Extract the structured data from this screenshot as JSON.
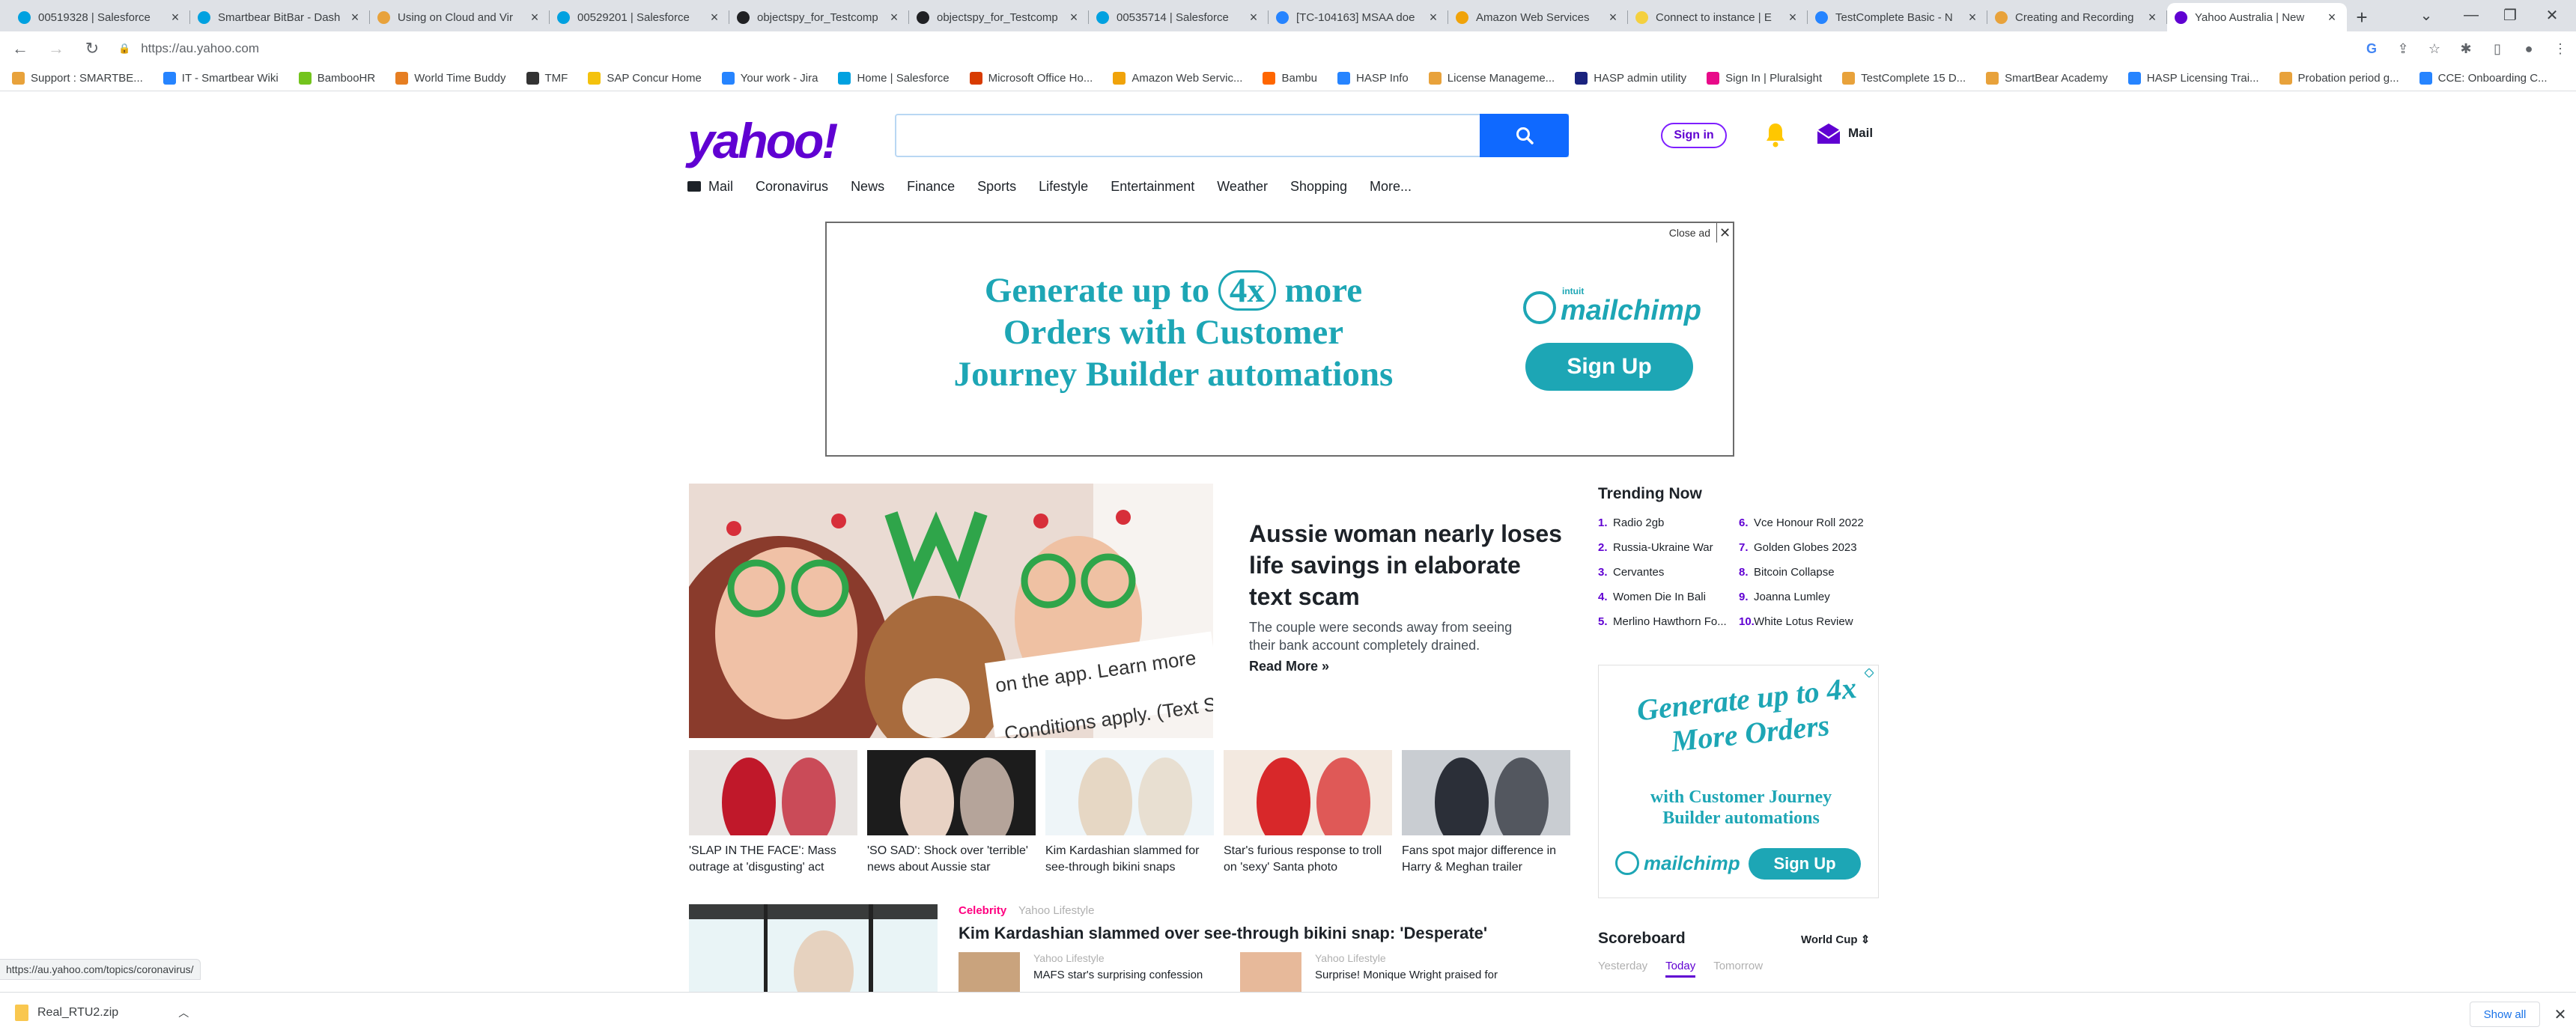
{
  "browser": {
    "tabs": [
      {
        "title": "00519328 | Salesforce",
        "color": "#00a1e0",
        "icon": "salesforce-icon"
      },
      {
        "title": "Smartbear BitBar - Dash",
        "color": "#00a1e0",
        "icon": "bitbar-icon"
      },
      {
        "title": "Using on Cloud and Vir",
        "color": "#e8a23b",
        "icon": "confluence-icon"
      },
      {
        "title": "00529201 | Salesforce",
        "color": "#00a1e0",
        "icon": "salesforce-icon"
      },
      {
        "title": "objectspy_for_Testcomp",
        "color": "#202124",
        "icon": "github-icon"
      },
      {
        "title": "objectspy_for_Testcomp",
        "color": "#202124",
        "icon": "github-icon"
      },
      {
        "title": "00535714 | Salesforce",
        "color": "#00a1e0",
        "icon": "salesforce-icon"
      },
      {
        "title": "[TC-104163] MSAA doe",
        "color": "#2684ff",
        "icon": "jira-icon"
      },
      {
        "title": "Amazon Web Services",
        "color": "#f0a30a",
        "icon": "aws-icon"
      },
      {
        "title": "Connect to instance | E",
        "color": "#f4d03f",
        "icon": "aws-doc-icon"
      },
      {
        "title": "TestComplete Basic - N",
        "color": "#2684ff",
        "icon": "testcomplete-icon"
      },
      {
        "title": "Creating and Recording",
        "color": "#e8a23b",
        "icon": "confluence-icon"
      },
      {
        "title": "Yahoo Australia | New",
        "color": "#6001d2",
        "icon": "yahoo-icon",
        "active": true
      }
    ],
    "url": "https://au.yahoo.com",
    "bookmarks": [
      {
        "label": "Support : SMARTBE...",
        "color": "#e8a23b"
      },
      {
        "label": "IT - Smartbear Wiki",
        "color": "#2684ff"
      },
      {
        "label": "BambooHR",
        "color": "#73c41d"
      },
      {
        "label": "World Time Buddy",
        "color": "#e67e22"
      },
      {
        "label": "TMF",
        "color": "#333333"
      },
      {
        "label": "SAP Concur Home",
        "color": "#f4c20d"
      },
      {
        "label": "Your work - Jira",
        "color": "#2684ff"
      },
      {
        "label": "Home | Salesforce",
        "color": "#00a1e0"
      },
      {
        "label": "Microsoft Office Ho...",
        "color": "#d83b01"
      },
      {
        "label": "Amazon Web Servic...",
        "color": "#f0a30a"
      },
      {
        "label": "Bambu",
        "color": "#ff6600"
      },
      {
        "label": "HASP Info",
        "color": "#2684ff"
      },
      {
        "label": "License Manageme...",
        "color": "#e8a23b"
      },
      {
        "label": "HASP admin utility",
        "color": "#1a237e"
      },
      {
        "label": "Sign In | Pluralsight",
        "color": "#e80a89"
      },
      {
        "label": "TestComplete 15 D...",
        "color": "#e8a23b"
      },
      {
        "label": "SmartBear Academy",
        "color": "#e8a23b"
      },
      {
        "label": "HASP Licensing Trai...",
        "color": "#2684ff"
      },
      {
        "label": "Probation period g...",
        "color": "#e8a23b"
      },
      {
        "label": "CCE: Onboarding C...",
        "color": "#2684ff"
      }
    ],
    "status_url": "https://au.yahoo.com/topics/coronavirus/",
    "download": {
      "filename": "Real_RTU2.zip",
      "show_all": "Show all"
    }
  },
  "yahoo": {
    "logo": "yahoo!",
    "sign_in": "Sign in",
    "mail_label": "Mail",
    "nav": [
      "Mail",
      "Coronavirus",
      "News",
      "Finance",
      "Sports",
      "Lifestyle",
      "Entertainment",
      "Weather",
      "Shopping",
      "More..."
    ],
    "ad": {
      "close_label": "Close ad",
      "line1_pre": "Generate up to ",
      "line1_circle": "4x",
      "line1_post": " more",
      "line2": "Orders with Customer",
      "line3": "Journey Builder automations",
      "brand_small": "intuit",
      "brand": "mailchimp",
      "cta": "Sign Up"
    },
    "hero": {
      "image_caption_1": "on the app. Learn more",
      "image_caption_2": "Conditions apply. (Text ST",
      "headline": "Aussie woman nearly loses life savings in elaborate text scam",
      "summary": "The couple were seconds away from seeing their bank account completely drained.",
      "read_more": "Read More »"
    },
    "thumbs": [
      {
        "title": "'SLAP IN THE FACE': Mass outrage at 'disgusting' act",
        "bg": "#e8e4e2",
        "accent": "#c0182a"
      },
      {
        "title": "'SO SAD': Shock over 'terrible' news about Aussie star",
        "bg": "#1c1c1c",
        "accent": "#e8d2c4"
      },
      {
        "title": "Kim Kardashian slammed for see-through bikini snaps",
        "bg": "#eef5f8",
        "accent": "#e6d7c4"
      },
      {
        "title": "Star's furious response to troll on 'sexy' Santa photo",
        "bg": "#f3e9e0",
        "accent": "#d8282a"
      },
      {
        "title": "Fans spot major difference in Harry & Meghan trailer",
        "bg": "#c9cdd2",
        "accent": "#2b2f38"
      }
    ],
    "bottom_story": {
      "category": "Celebrity",
      "source": "Yahoo Lifestyle",
      "headline": "Kim Kardashian slammed over see-through bikini snap: 'Desperate'",
      "sub1_source": "Yahoo Lifestyle",
      "sub1_title": "MAFS star's surprising confession",
      "sub2_source": "Yahoo Lifestyle",
      "sub2_title": "Surprise! Monique Wright praised for"
    },
    "trending": {
      "title": "Trending Now",
      "left": [
        {
          "n": "1.",
          "label": "Radio 2gb"
        },
        {
          "n": "2.",
          "label": "Russia-Ukraine War"
        },
        {
          "n": "3.",
          "label": "Cervantes"
        },
        {
          "n": "4.",
          "label": "Women Die In Bali"
        },
        {
          "n": "5.",
          "label": "Merlino Hawthorn Fo..."
        }
      ],
      "right": [
        {
          "n": "6.",
          "label": "Vce Honour Roll 2022"
        },
        {
          "n": "7.",
          "label": "Golden Globes 2023"
        },
        {
          "n": "8.",
          "label": "Bitcoin Collapse"
        },
        {
          "n": "9.",
          "label": "Joanna Lumley"
        },
        {
          "n": "10.",
          "label": "White Lotus Review"
        }
      ]
    },
    "side_ad": {
      "line1": "Generate up to 4x More Orders",
      "line2": "with Customer Journey Builder automations",
      "brand": "mailchimp",
      "cta": "Sign Up"
    },
    "scoreboard": {
      "title": "Scoreboard",
      "selector": "World Cup",
      "tabs": [
        "Yesterday",
        "Today",
        "Tomorrow"
      ],
      "active_tab": "Today"
    }
  }
}
